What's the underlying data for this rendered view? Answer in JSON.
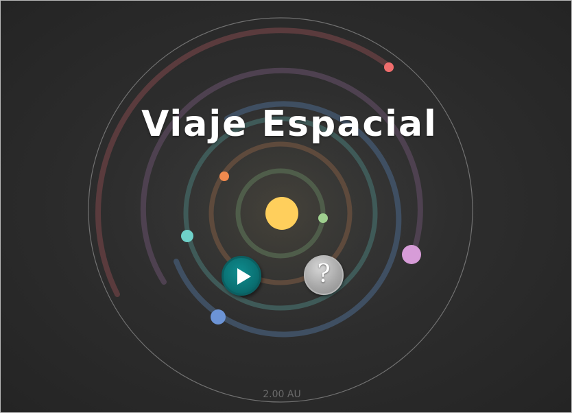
{
  "title": "Viaje Espacial",
  "scale_label": "2.00 AU",
  "buttons": {
    "play": "play",
    "help": "?"
  },
  "colors": {
    "background": "#2b2b2b",
    "sun": "#ffcf5c",
    "play_button": "#0a7173",
    "help_button": "#a9a9a9",
    "title": "#ffffff"
  },
  "planets": [
    {
      "name": "green-planet",
      "color": "#9fd08f"
    },
    {
      "name": "orange-planet",
      "color": "#f08a4e"
    },
    {
      "name": "cyan-planet",
      "color": "#6fd1c9"
    },
    {
      "name": "blue-planet",
      "color": "#6c94d6"
    },
    {
      "name": "purple-planet",
      "color": "#d79cd8"
    },
    {
      "name": "red-planet",
      "color": "#f06d6d"
    }
  ]
}
